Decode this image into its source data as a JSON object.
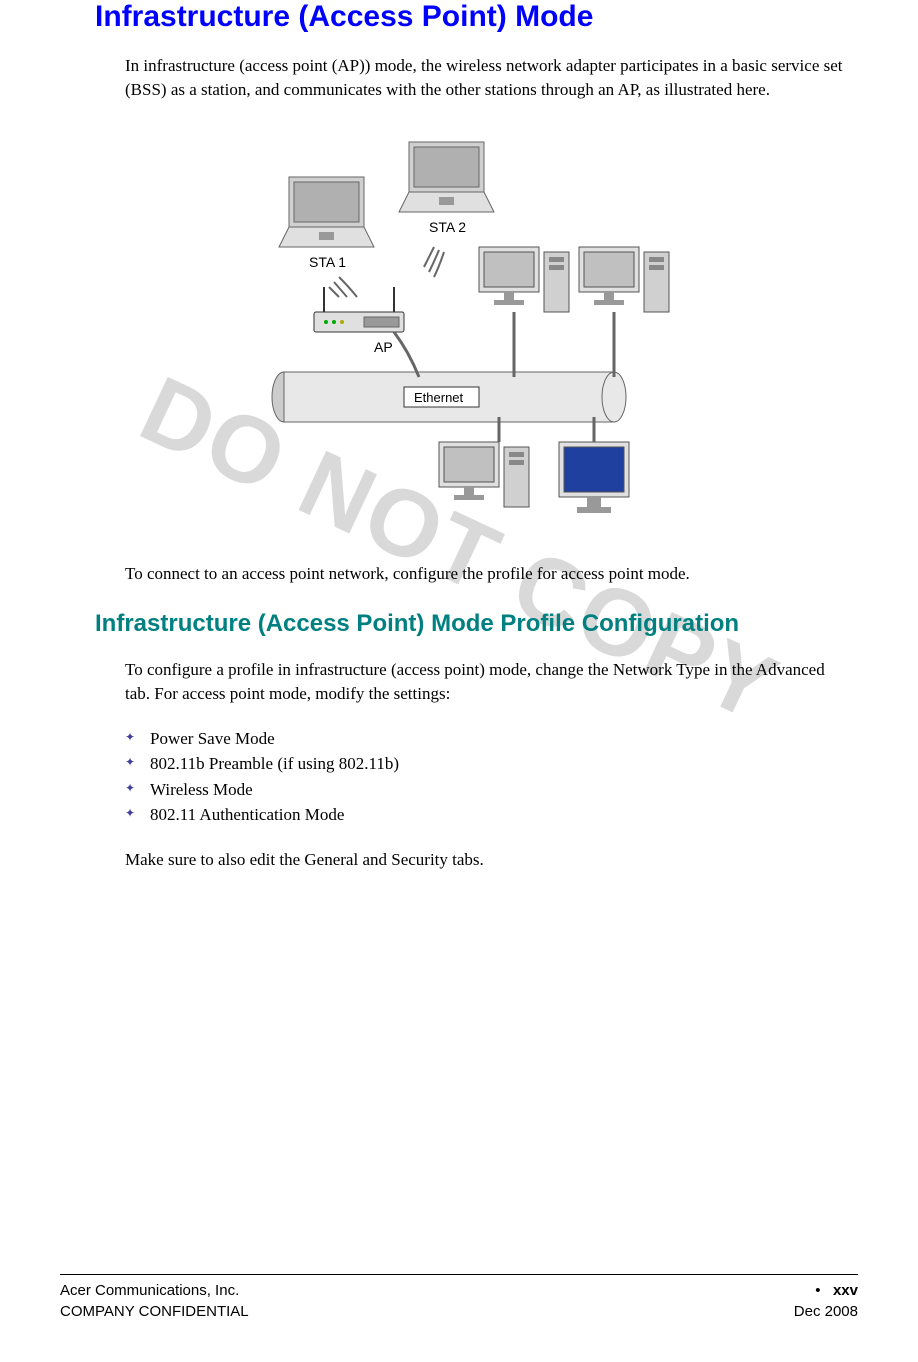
{
  "heading1": "Infrastructure (Access Point) Mode",
  "paragraph1": "In infrastructure (access point (AP)) mode, the wireless network adapter participates in a basic service set (BSS) as a station, and communicates with the other stations through an AP, as illustrated here.",
  "paragraph2": "To connect to an access point network, configure the profile for access point mode.",
  "heading2": "Infrastructure (Access Point) Mode Profile Configuration",
  "paragraph3": "To configure a profile in infrastructure (access point) mode, change the Network Type in the Advanced tab. For access point mode, modify the settings:",
  "bullets": [
    "Power Save Mode",
    "802.11b Preamble (if using 802.11b)",
    "Wireless Mode",
    "802.11 Authentication Mode"
  ],
  "paragraph4": "Make sure to also edit the General and Security tabs.",
  "watermark": "DO NOT COPY",
  "diagram": {
    "sta1": "STA 1",
    "sta2": "STA 2",
    "ap": "AP",
    "ethernet": "Ethernet"
  },
  "footer": {
    "company": "Acer Communications, Inc.",
    "confidential": "COMPANY CONFIDENTIAL",
    "page_marker": "•",
    "page_num": "xxv",
    "date": "Dec 2008"
  }
}
